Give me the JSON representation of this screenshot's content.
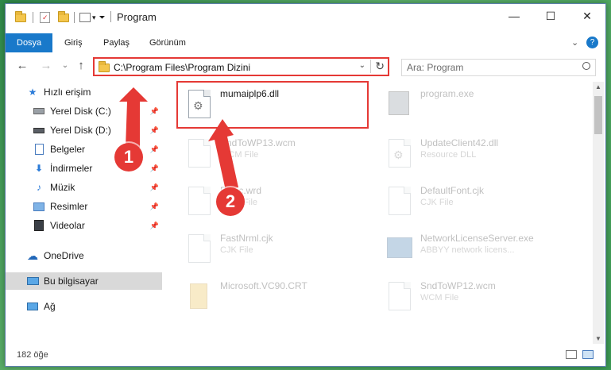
{
  "window": {
    "title": "Program",
    "minimize": "—",
    "maximize": "☐",
    "close": "✕"
  },
  "ribbon": {
    "tabs": [
      {
        "label": "Dosya"
      },
      {
        "label": "Giriş"
      },
      {
        "label": "Paylaş"
      },
      {
        "label": "Görünüm"
      }
    ],
    "expand": "⌄",
    "help": "?"
  },
  "address": {
    "path": "C:\\Program Files\\Program Dizini",
    "dropdown": "⌄",
    "refresh": "↻"
  },
  "nav": {
    "back": "←",
    "forward": "→",
    "recent": "⌄",
    "up": "↑"
  },
  "search": {
    "placeholder": "Ara: Program",
    "icon": "search-icon"
  },
  "sidebar": {
    "items": [
      {
        "label": "Hızlı erişim",
        "icon": "star-icon"
      },
      {
        "label": "Yerel Disk (C:)",
        "icon": "drive-icon"
      },
      {
        "label": "Yerel Disk (D:)",
        "icon": "drive-icon"
      },
      {
        "label": "Belgeler",
        "icon": "documents-icon"
      },
      {
        "label": "İndirmeler",
        "icon": "download-icon"
      },
      {
        "label": "Müzik",
        "icon": "music-icon"
      },
      {
        "label": "Resimler",
        "icon": "pictures-icon"
      },
      {
        "label": "Videolar",
        "icon": "video-icon"
      },
      {
        "label": "OneDrive",
        "icon": "cloud-icon"
      },
      {
        "label": "Bu bilgisayar",
        "icon": "computer-icon"
      },
      {
        "label": "Ağ",
        "icon": "network-icon"
      }
    ]
  },
  "files": {
    "selected": {
      "name": "mumaiplp6.dll"
    },
    "items": [
      {
        "name": "program.exe",
        "type": ""
      },
      {
        "name": "SndToWP13.wcm",
        "type": "WCM File"
      },
      {
        "name": "UpdateClient42.dll",
        "type": "Resource DLL"
      },
      {
        "name": "Basic.wrd",
        "type": "WRD File"
      },
      {
        "name": "DefaultFont.cjk",
        "type": "CJK File"
      },
      {
        "name": "FastNrml.cjk",
        "type": "CJK File"
      },
      {
        "name": "NetworkLicenseServer.exe",
        "type": "ABBYY network licens..."
      },
      {
        "name": "Microsoft.VC90.CRT",
        "type": ""
      },
      {
        "name": "SndToWP12.wcm",
        "type": "WCM File"
      }
    ]
  },
  "status": {
    "count": "182 öğe"
  },
  "annotations": {
    "step1": "1",
    "step2": "2",
    "color": "#e53935"
  }
}
